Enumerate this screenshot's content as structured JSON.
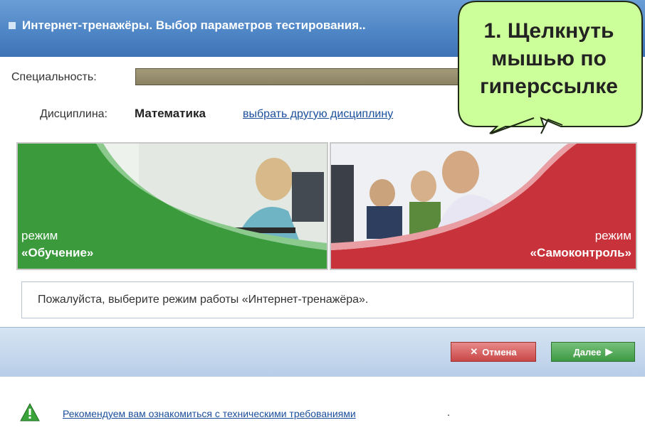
{
  "window": {
    "title": "Интернет-тренажёры. Выбор параметров тестирования.."
  },
  "form": {
    "specialty_label": "Специальность:",
    "specialty_value": "",
    "discipline_label": "Дисциплина:",
    "discipline_value": "Математика",
    "change_discipline_link": "выбрать другую дисциплину"
  },
  "modes": [
    {
      "line1": "режим",
      "line2": "«Обучение»",
      "color": "#3a9a3c"
    },
    {
      "line1": "режим",
      "line2": "«Самоконтроль»",
      "color": "#c8323a"
    }
  ],
  "message": "Пожалуйста, выберите режим работы «Интернет-тренажёра».",
  "buttons": {
    "cancel": "Отмена",
    "next": "Далее"
  },
  "footer": {
    "requirements_link": "Рекомендуем вам ознакомиться с техническими требованиями",
    "requirements_tail": "."
  },
  "callout": {
    "lines": [
      "1. Щелкнуть",
      "мышью по",
      "гиперссылке"
    ],
    "fill": "#ccff99"
  }
}
